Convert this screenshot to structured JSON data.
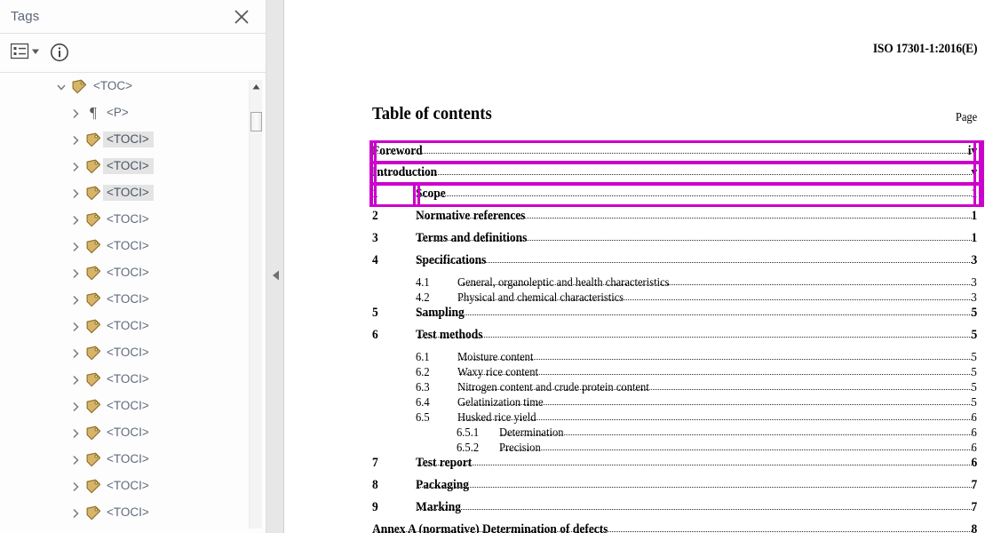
{
  "panel": {
    "title": "Tags",
    "close_label": "Close",
    "options_icon": "list-options-icon",
    "info_icon": "info-circle-icon"
  },
  "tree": [
    {
      "label": "<TOC>",
      "depth": 0,
      "icon": "tag-icon",
      "twisty": "expanded",
      "selected": false
    },
    {
      "label": "<P>",
      "depth": 1,
      "icon": "paragraph-icon",
      "twisty": "collapsed",
      "selected": false
    },
    {
      "label": "<TOCI>",
      "depth": 1,
      "icon": "tag-icon",
      "twisty": "collapsed",
      "selected": true
    },
    {
      "label": "<TOCI>",
      "depth": 1,
      "icon": "tag-icon",
      "twisty": "collapsed",
      "selected": true
    },
    {
      "label": "<TOCI>",
      "depth": 1,
      "icon": "tag-icon",
      "twisty": "collapsed",
      "selected": true
    },
    {
      "label": "<TOCI>",
      "depth": 1,
      "icon": "tag-icon",
      "twisty": "collapsed",
      "selected": false
    },
    {
      "label": "<TOCI>",
      "depth": 1,
      "icon": "tag-icon",
      "twisty": "collapsed",
      "selected": false
    },
    {
      "label": "<TOCI>",
      "depth": 1,
      "icon": "tag-icon",
      "twisty": "collapsed",
      "selected": false
    },
    {
      "label": "<TOCI>",
      "depth": 1,
      "icon": "tag-icon",
      "twisty": "collapsed",
      "selected": false
    },
    {
      "label": "<TOCI>",
      "depth": 1,
      "icon": "tag-icon",
      "twisty": "collapsed",
      "selected": false
    },
    {
      "label": "<TOCI>",
      "depth": 1,
      "icon": "tag-icon",
      "twisty": "collapsed",
      "selected": false
    },
    {
      "label": "<TOCI>",
      "depth": 1,
      "icon": "tag-icon",
      "twisty": "collapsed",
      "selected": false
    },
    {
      "label": "<TOCI>",
      "depth": 1,
      "icon": "tag-icon",
      "twisty": "collapsed",
      "selected": false
    },
    {
      "label": "<TOCI>",
      "depth": 1,
      "icon": "tag-icon",
      "twisty": "collapsed",
      "selected": false
    },
    {
      "label": "<TOCI>",
      "depth": 1,
      "icon": "tag-icon",
      "twisty": "collapsed",
      "selected": false
    },
    {
      "label": "<TOCI>",
      "depth": 1,
      "icon": "tag-icon",
      "twisty": "collapsed",
      "selected": false
    },
    {
      "label": "<TOCI>",
      "depth": 1,
      "icon": "tag-icon",
      "twisty": "collapsed",
      "selected": false
    }
  ],
  "document": {
    "header": "ISO 17301-1:2016(E)",
    "title": "Table of contents",
    "page_column_label": "Page",
    "toc": [
      {
        "num": "",
        "text": "Foreword",
        "page": "iv",
        "level": "front",
        "bold": true,
        "highlight": true
      },
      {
        "num": "",
        "text": "Introduction",
        "page": "v",
        "level": "front",
        "bold": true,
        "highlight": true
      },
      {
        "num": "1",
        "text": "Scope",
        "page": "1",
        "level": "lvl1",
        "bold": true,
        "highlight": true
      },
      {
        "num": "2",
        "text": "Normative references",
        "page": "1",
        "level": "lvl1",
        "bold": true,
        "highlight": false
      },
      {
        "num": "3",
        "text": "Terms and definitions",
        "page": "1",
        "level": "lvl1",
        "bold": true,
        "highlight": false
      },
      {
        "num": "4",
        "text": "Specifications",
        "page": "3",
        "level": "lvl1",
        "bold": true,
        "highlight": false
      },
      {
        "num": "4.1",
        "text": "General, organoleptic and health characteristics",
        "page": "3",
        "level": "lvl2",
        "bold": false,
        "highlight": false
      },
      {
        "num": "4.2",
        "text": "Physical and chemical characteristics",
        "page": "3",
        "level": "lvl2",
        "bold": false,
        "highlight": false
      },
      {
        "num": "5",
        "text": "Sampling",
        "page": "5",
        "level": "lvl1",
        "bold": true,
        "highlight": false
      },
      {
        "num": "6",
        "text": "Test methods",
        "page": "5",
        "level": "lvl1",
        "bold": true,
        "highlight": false
      },
      {
        "num": "6.1",
        "text": "Moisture content",
        "page": "5",
        "level": "lvl2",
        "bold": false,
        "highlight": false
      },
      {
        "num": "6.2",
        "text": "Waxy rice content",
        "page": "5",
        "level": "lvl2",
        "bold": false,
        "highlight": false
      },
      {
        "num": "6.3",
        "text": "Nitrogen content and crude protein content",
        "page": "5",
        "level": "lvl2",
        "bold": false,
        "highlight": false
      },
      {
        "num": "6.4",
        "text": "Gelatinization time",
        "page": "5",
        "level": "lvl2",
        "bold": false,
        "highlight": false
      },
      {
        "num": "6.5",
        "text": "Husked rice yield",
        "page": "6",
        "level": "lvl2",
        "bold": false,
        "highlight": false
      },
      {
        "num": "6.5.1",
        "text": "Determination",
        "page": "6",
        "level": "lvl3",
        "bold": false,
        "highlight": false
      },
      {
        "num": "6.5.2",
        "text": "Precision",
        "page": "6",
        "level": "lvl3",
        "bold": false,
        "highlight": false
      },
      {
        "num": "7",
        "text": "Test report",
        "page": "6",
        "level": "lvl1",
        "bold": true,
        "highlight": false
      },
      {
        "num": "8",
        "text": "Packaging",
        "page": "7",
        "level": "lvl1",
        "bold": true,
        "highlight": false
      },
      {
        "num": "9",
        "text": "Marking",
        "page": "7",
        "level": "lvl1",
        "bold": true,
        "highlight": false
      },
      {
        "num": "",
        "text": "Annex A (normative) Determination of defects",
        "page": "8",
        "level": "annex",
        "bold": true,
        "highlight": false
      }
    ]
  },
  "colors": {
    "highlight": "#cc00cc",
    "selection": "#e4e4e4",
    "tree_text": "#606a7a",
    "tag_icon": "#c8a04a"
  }
}
